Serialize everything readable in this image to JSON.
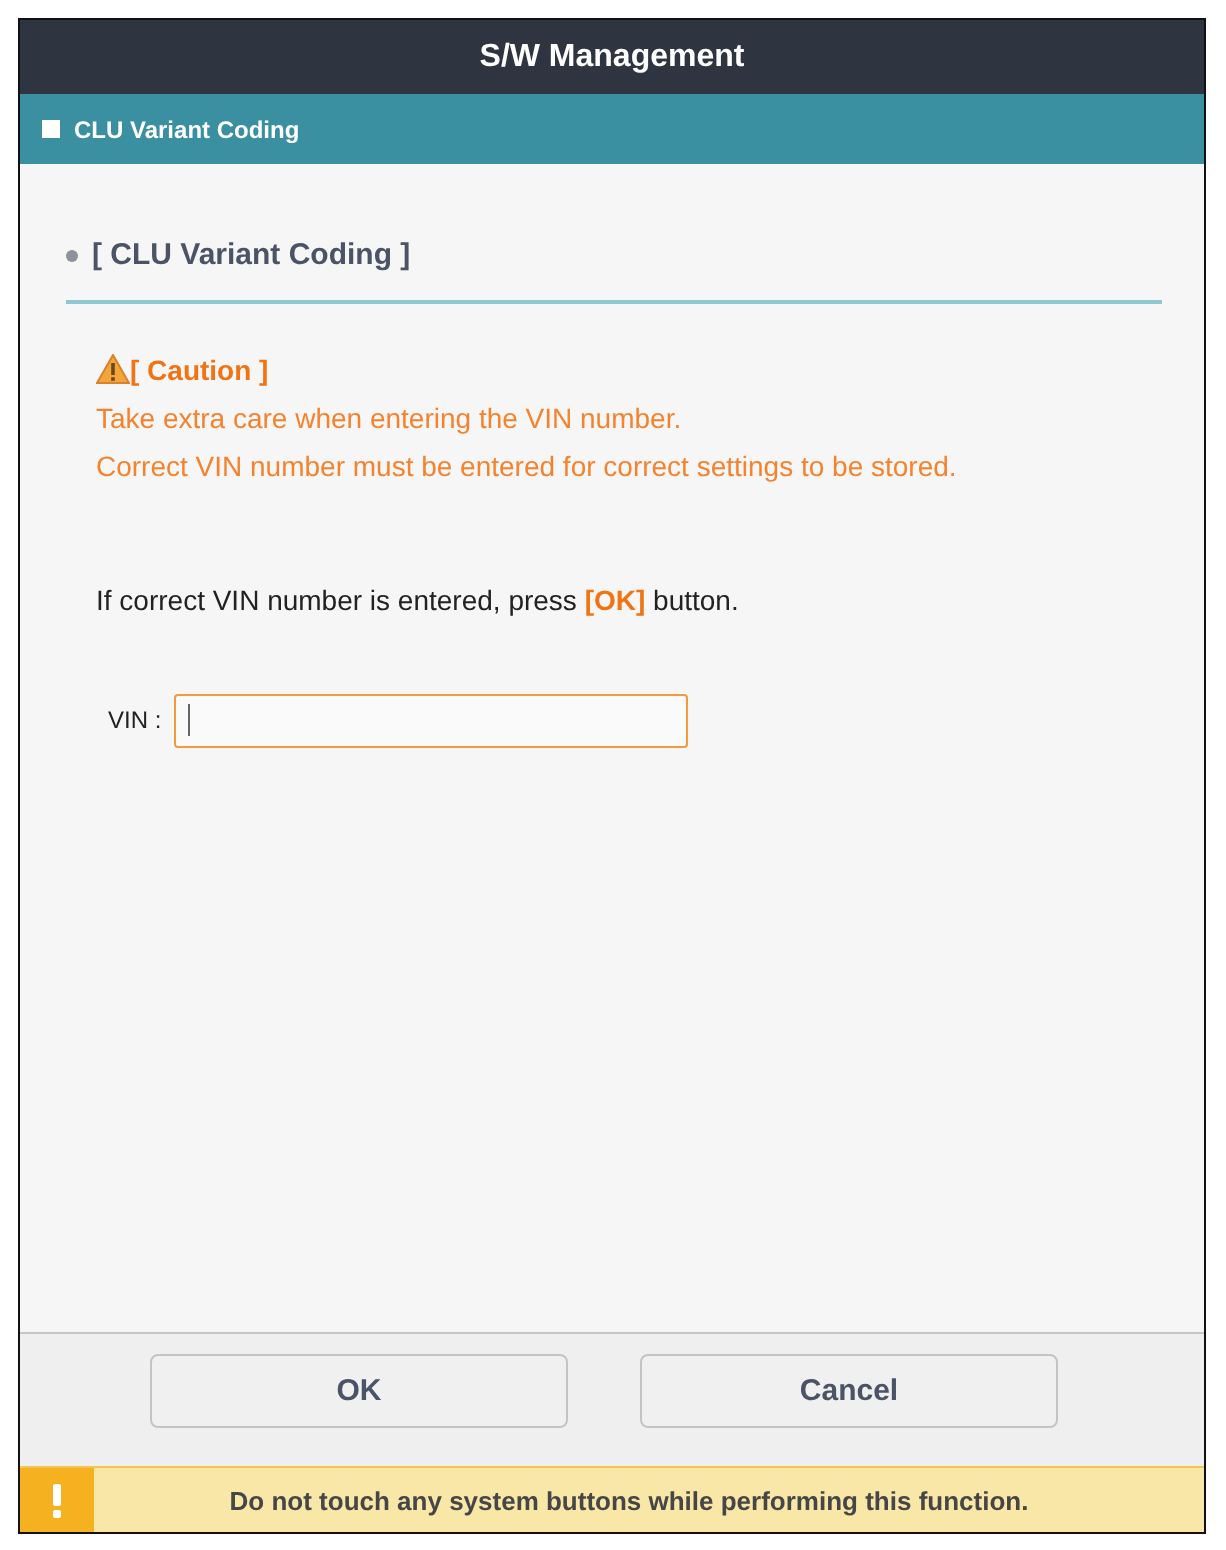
{
  "window": {
    "title": "S/W Management"
  },
  "section_bar": {
    "title": "CLU Variant Coding"
  },
  "heading": "[ CLU Variant Coding ]",
  "caution": {
    "title": "[ Caution ]",
    "lines": [
      "Take extra care when entering the VIN number.",
      "Correct VIN number must be entered for correct settings to be stored."
    ]
  },
  "instruction": "If correct VIN number is entered, press **[OK]** button.",
  "vin_field": {
    "label": "VIN :",
    "focused": true
  },
  "buttons": [
    {
      "label": "OK"
    },
    {
      "label": "Cancel"
    }
  ],
  "warning_bar": {
    "text": "Do not touch any system buttons while performing this function."
  }
}
